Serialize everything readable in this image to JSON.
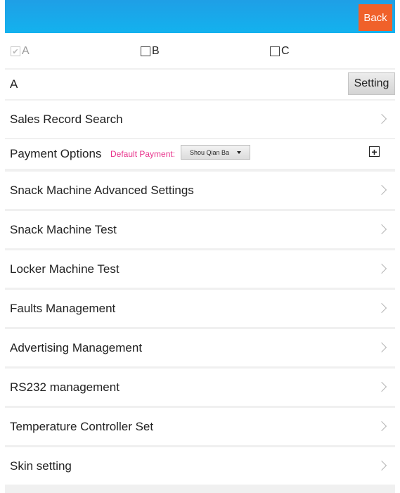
{
  "header": {
    "back_label": "Back"
  },
  "checkboxes": [
    {
      "label": "A",
      "checked": true
    },
    {
      "label": "B",
      "checked": false
    },
    {
      "label": "C",
      "checked": false
    }
  ],
  "machine_row": {
    "label": "A",
    "setting_label": "Setting"
  },
  "sales_record": {
    "label": "Sales Record Search"
  },
  "payment": {
    "label": "Payment Options",
    "default_label": "Default Payment:",
    "selected": "Shou Qian Ba",
    "add_symbol": "+"
  },
  "menu": [
    {
      "label": "Snack Machine Advanced Settings"
    },
    {
      "label": "Snack Machine Test"
    },
    {
      "label": "Locker Machine Test"
    },
    {
      "label": "Faults Management"
    },
    {
      "label": "Advertising Management"
    },
    {
      "label": "RS232 management"
    },
    {
      "label": "Temperature Controller Set"
    },
    {
      "label": "Skin setting"
    }
  ],
  "colors": {
    "header": "#1a9fe6",
    "back_button": "#f0612a",
    "default_payment_text": "#e8318a"
  }
}
